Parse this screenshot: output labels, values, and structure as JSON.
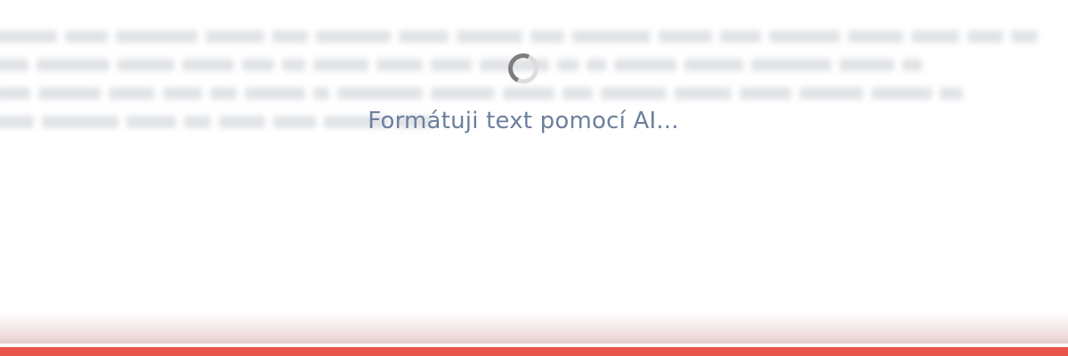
{
  "loader": {
    "status_text": "Formátuji text pomocí AI..."
  },
  "colors": {
    "status_text": "#6c7f9e",
    "accent_bar": "#e8564b",
    "spinner_track": "#dcdcdc",
    "spinner_head": "#7d7d7d"
  },
  "icons": {
    "spinner": "spinner-icon"
  }
}
